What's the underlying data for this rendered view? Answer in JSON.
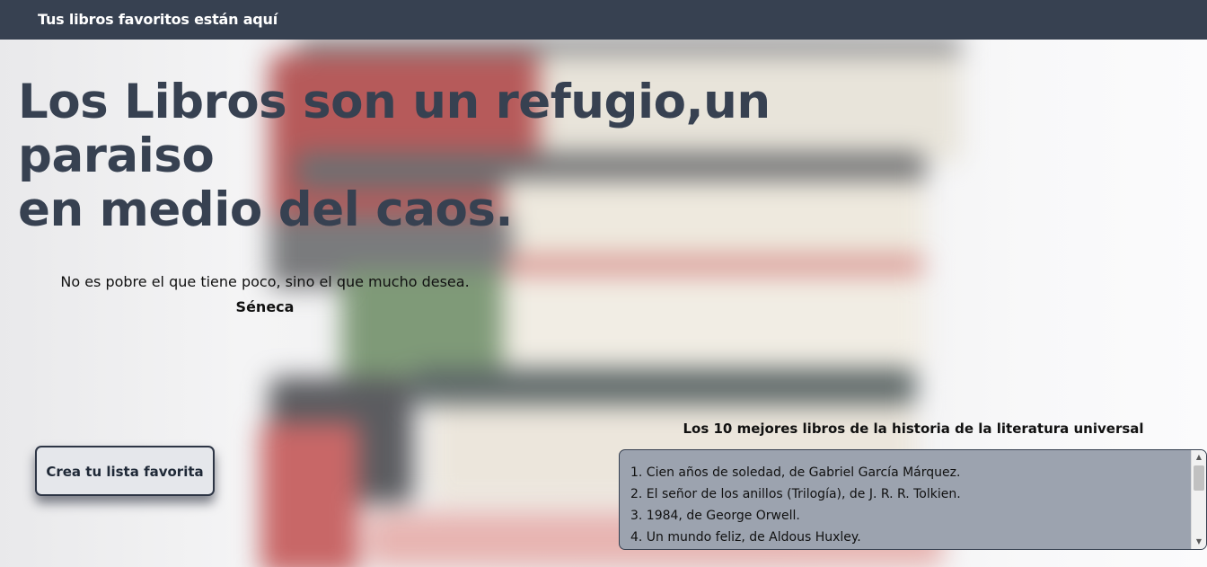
{
  "navbar": {
    "brand": "Tus libros favoritos están aquí"
  },
  "hero": {
    "line1": "Los Libros son un refugio,un",
    "line2": "paraiso",
    "line3": "en medio del caos."
  },
  "quote": {
    "text": "No es pobre el que tiene poco, sino el que mucho desea.",
    "author": "Séneca"
  },
  "cta": {
    "label": "Crea tu lista favorita"
  },
  "top_books": {
    "title": "Los 10 mejores libros de la historia de la literatura universal",
    "items": [
      "1. Cien años de soledad, de Gabriel García Márquez.",
      "2. El señor de los anillos (Trilogía), de J. R. R. Tolkien.",
      "3. 1984, de George Orwell.",
      "4. Un mundo feliz, de Aldous Huxley."
    ]
  },
  "colors": {
    "navbar_bg": "#374151",
    "heading_text": "#374151",
    "button_bg": "#e5e7eb",
    "list_bg": "#9ca3af"
  },
  "icons": {
    "scroll_up": "scroll-up-arrow-icon",
    "scroll_down": "scroll-down-arrow-icon"
  }
}
